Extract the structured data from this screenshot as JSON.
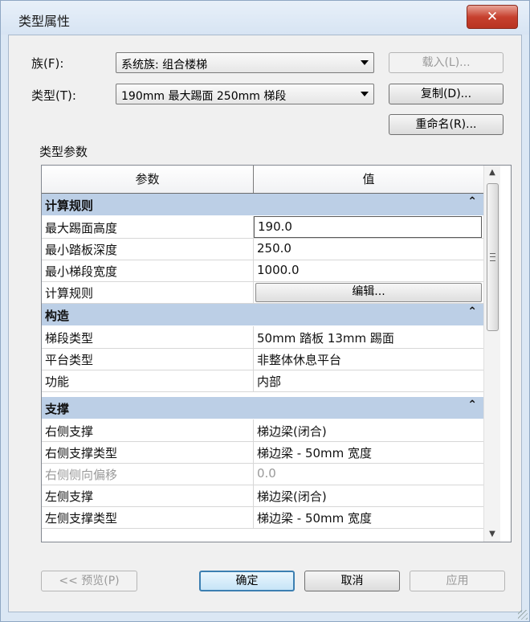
{
  "window": {
    "title": "类型属性",
    "close_label": "✕"
  },
  "family": {
    "label": "族(F):",
    "value": "系统族: 组合楼梯"
  },
  "type": {
    "label": "类型(T):",
    "value": "190mm 最大踢面 250mm 梯段"
  },
  "buttons": {
    "load": "载入(L)...",
    "duplicate": "复制(D)...",
    "rename": "重命名(R)...",
    "preview": "<< 预览(P)",
    "ok": "确定",
    "cancel": "取消",
    "apply": "应用"
  },
  "section_label": "类型参数",
  "grid": {
    "headers": {
      "param": "参数",
      "value": "值"
    },
    "groups": [
      {
        "name": "计算规则",
        "rows": [
          {
            "param": "最大踢面高度",
            "value": "190.0",
            "kind": "input"
          },
          {
            "param": "最小踏板深度",
            "value": "250.0"
          },
          {
            "param": "最小梯段宽度",
            "value": "1000.0"
          },
          {
            "param": "计算规则",
            "value": "编辑...",
            "kind": "button"
          }
        ]
      },
      {
        "name": "构造",
        "rows": [
          {
            "param": "梯段类型",
            "value": "50mm 踏板 13mm 踢面"
          },
          {
            "param": "平台类型",
            "value": "非整体休息平台"
          },
          {
            "param": "功能",
            "value": "内部"
          }
        ]
      },
      {
        "name": "支撑",
        "rows": [
          {
            "param": "右侧支撑",
            "value": "梯边梁(闭合)"
          },
          {
            "param": "右侧支撑类型",
            "value": "梯边梁 - 50mm 宽度"
          },
          {
            "param": "右侧侧向偏移",
            "value": "0.0",
            "muted": true
          },
          {
            "param": "左侧支撑",
            "value": "梯边梁(闭合)"
          },
          {
            "param": "左侧支撑类型",
            "value": "梯边梁 - 50mm 宽度"
          }
        ]
      }
    ]
  },
  "icons": {
    "collapse": "chevron-double-up",
    "scroll_up": "arrow-up",
    "scroll_down": "arrow-down"
  }
}
